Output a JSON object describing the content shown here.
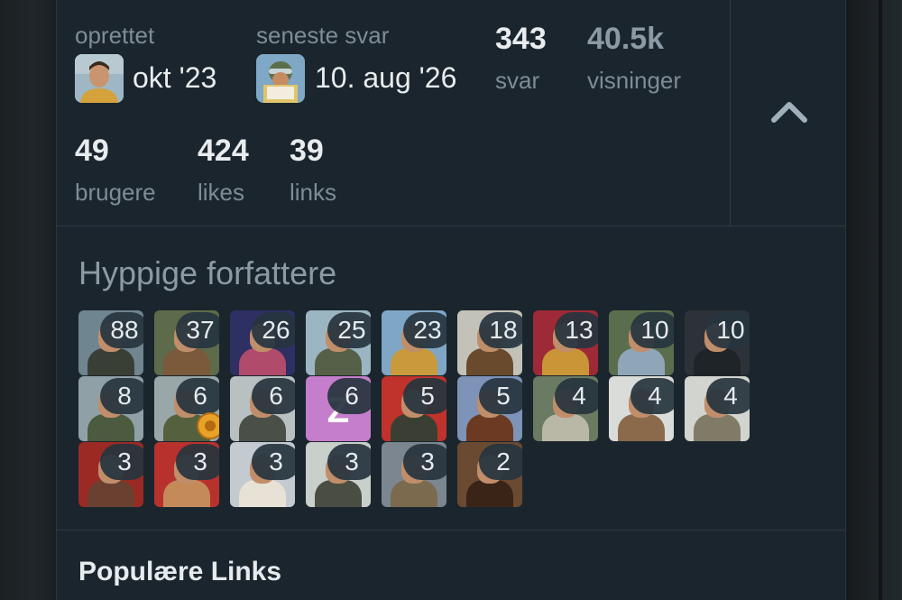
{
  "topic_meta": {
    "created": {
      "label": "oprettet",
      "value": "okt '23",
      "avatar_icon": "user-avatar-man-yellow-jacket"
    },
    "last_reply": {
      "label": "seneste svar",
      "value": "10. aug '26",
      "avatar_icon": "user-avatar-pilot-reading"
    },
    "replies": {
      "number": "343",
      "label": "svar"
    },
    "views": {
      "number": "40.5k",
      "label": "visninger"
    },
    "users": {
      "number": "49",
      "label": "brugere"
    },
    "likes": {
      "number": "424",
      "label": "likes"
    },
    "links": {
      "number": "39",
      "label": "links"
    },
    "toggle_icon": "chevron-up-icon"
  },
  "frequent_posters": {
    "heading": "Hyppige forfattere",
    "users": [
      {
        "count": "88",
        "bg": "#6f8590",
        "fig": "#3a3f36"
      },
      {
        "count": "37",
        "bg": "#5d6b4a",
        "fig": "#7a5a3a"
      },
      {
        "count": "26",
        "bg": "#2e2f63",
        "fig": "#b04b6b"
      },
      {
        "count": "25",
        "bg": "#9bb6c2",
        "fig": "#566048"
      },
      {
        "count": "23",
        "bg": "#7fa6c5",
        "fig": "#c89a3c"
      },
      {
        "count": "18",
        "bg": "#c3c2b8",
        "fig": "#6a4a2d"
      },
      {
        "count": "13",
        "bg": "#9d2a36",
        "fig": "#c99537"
      },
      {
        "count": "10",
        "bg": "#5a6e4e",
        "fig": "#8fa6b8"
      },
      {
        "count": "10",
        "bg": "#2c3238",
        "fig": "#1f2428"
      },
      {
        "count": "8",
        "bg": "#8fa1a7",
        "fig": "#4c5a3f"
      },
      {
        "count": "6",
        "bg": "#9aa7a9",
        "fig": "#55603f",
        "badge": "gold-medal-badge"
      },
      {
        "count": "6",
        "bg": "#b9c0c2",
        "fig": "#4a4f48"
      },
      {
        "count": "6",
        "bg": "#c57ecb",
        "fig": "#c57ecb",
        "letter": "Z"
      },
      {
        "count": "5",
        "bg": "#c0322c",
        "fig": "#3b3f33"
      },
      {
        "count": "5",
        "bg": "#7d93b7",
        "fig": "#6c3a22"
      },
      {
        "count": "4",
        "bg": "#6b7a62",
        "fig": "#b9b7a6"
      },
      {
        "count": "4",
        "bg": "#d9dcd8",
        "fig": "#8a6a4a"
      },
      {
        "count": "4",
        "bg": "#d2d4cf",
        "fig": "#7f7b66"
      },
      {
        "count": "3",
        "bg": "#9c2a24",
        "fig": "#6a4030"
      },
      {
        "count": "3",
        "bg": "#b7322d",
        "fig": "#c58a5a"
      },
      {
        "count": "3",
        "bg": "#c3cad0",
        "fig": "#e8e2d6"
      },
      {
        "count": "3",
        "bg": "#c9cfcb",
        "fig": "#4a4d42"
      },
      {
        "count": "3",
        "bg": "#7b8690",
        "fig": "#7c6a4f"
      },
      {
        "count": "2",
        "bg": "#6b4a32",
        "fig": "#3a2418"
      }
    ]
  },
  "popular_links": {
    "heading": "Populære Links"
  }
}
